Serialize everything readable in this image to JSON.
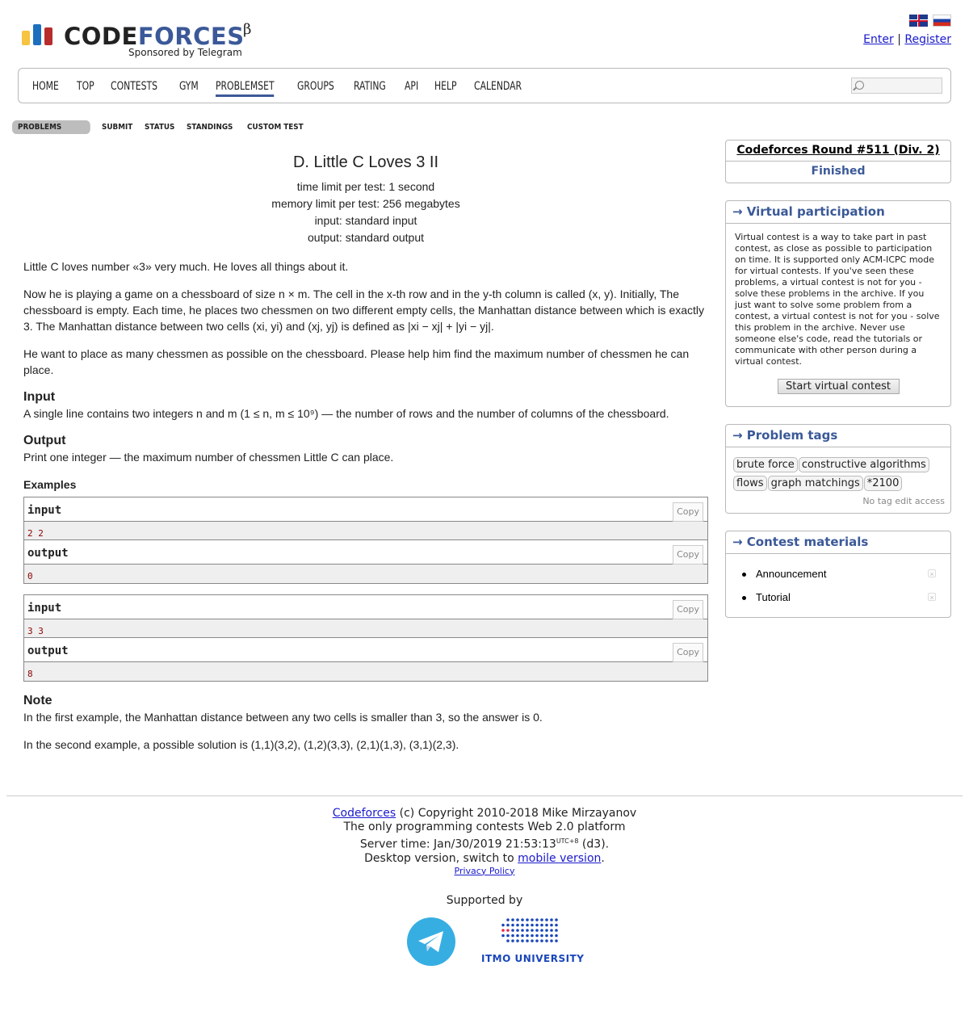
{
  "header": {
    "logo_code": "CODE",
    "logo_forces": "FORCES",
    "logo_beta": "β",
    "sponsor": "Sponsored by Telegram",
    "enter": "Enter",
    "register": "Register",
    "separator": "|"
  },
  "menu": [
    "HOME",
    "TOP",
    "CONTESTS",
    "GYM",
    "PROBLEMSET",
    "GROUPS",
    "RATING",
    "API",
    "HELP",
    "CALENDAR"
  ],
  "submenu": [
    "PROBLEMS",
    "SUBMIT",
    "STATUS",
    "STANDINGS",
    "CUSTOM TEST"
  ],
  "problem": {
    "title": "D. Little C Loves 3 II",
    "time_limit": "time limit per test: 1 second",
    "memory_limit": "memory limit per test: 256 megabytes",
    "input": "input: standard input",
    "output": "output: standard output",
    "statement_1": "Little C loves number «3» very much. He loves all things about it.",
    "statement_2": "Now he is playing a game on a chessboard of size n × m. The cell in the x-th row and in the y-th column is called (x, y). Initially, The chessboard is empty. Each time, he places two chessmen on two different empty cells, the Manhattan distance between which is exactly 3. The Manhattan distance between two cells (xi, yi) and (xj, yj) is defined as |xi − xj| + |yi − yj|.",
    "statement_3": "He want to place as many chessmen as possible on the chessboard. Please help him find the maximum number of chessmen he can place.",
    "input_title": "Input",
    "input_text": "A single line contains two integers n and m (1 ≤ n, m ≤ 10⁹) — the number of rows and the number of columns of the chessboard.",
    "output_title": "Output",
    "output_text": "Print one integer — the maximum number of chessmen Little C can place.",
    "examples_title": "Examples",
    "input_label": "input",
    "output_label": "output",
    "copy": "Copy",
    "examples": [
      {
        "input": "2 2",
        "output": "0"
      },
      {
        "input": "3 3",
        "output": "8"
      }
    ],
    "note_title": "Note",
    "note_1": "In the first example, the Manhattan distance between any two cells is smaller than 3, so the answer is 0.",
    "note_2": "In the second example, a possible solution is (1,1)(3,2), (1,2)(3,3), (2,1)(1,3), (3,1)(2,3)."
  },
  "sidebar": {
    "round_title": "Codeforces Round #511 (Div. 2)",
    "round_status": "Finished",
    "vp_caption": "→ Virtual participation",
    "vp_text": "Virtual contest is a way to take part in past contest, as close as possible to participation on time. It is supported only ACM-ICPC mode for virtual contests. If you've seen these problems, a virtual contest is not for you - solve these problems in the archive. If you just want to solve some problem from a contest, a virtual contest is not for you - solve this problem in the archive. Never use someone else's code, read the tutorials or communicate with other person during a virtual contest.",
    "vp_button": "Start virtual contest",
    "tags_caption": "→ Problem tags",
    "tags": [
      "brute force",
      "constructive algorithms",
      "flows",
      "graph matchings",
      "*2100"
    ],
    "tags_note": "No tag edit access",
    "materials_caption": "→ Contest materials",
    "materials": [
      "Announcement",
      "Tutorial"
    ]
  },
  "footer": {
    "link": "Codeforces",
    "copyright": " (c) Copyright 2010-2018 Mike Mirzayanov",
    "tagline": "The only programming contests Web 2.0 platform",
    "server_time": "Server time: Jan/30/2019 21:53:13",
    "utc": "UTC+8",
    "server_suffix": " (d3).",
    "desktop_prefix": "Desktop version, switch to ",
    "mobile_link": "mobile version",
    "desktop_suffix": ".",
    "privacy": "Privacy Policy",
    "supported_by": "Supported by",
    "itmo": "ITMO UNIVERSITY"
  },
  "colors": {
    "brand_blue": "#3b5998",
    "link_blue": "#1a1acc",
    "sample_text": "#8b0000",
    "telegram": "#37aee2"
  }
}
